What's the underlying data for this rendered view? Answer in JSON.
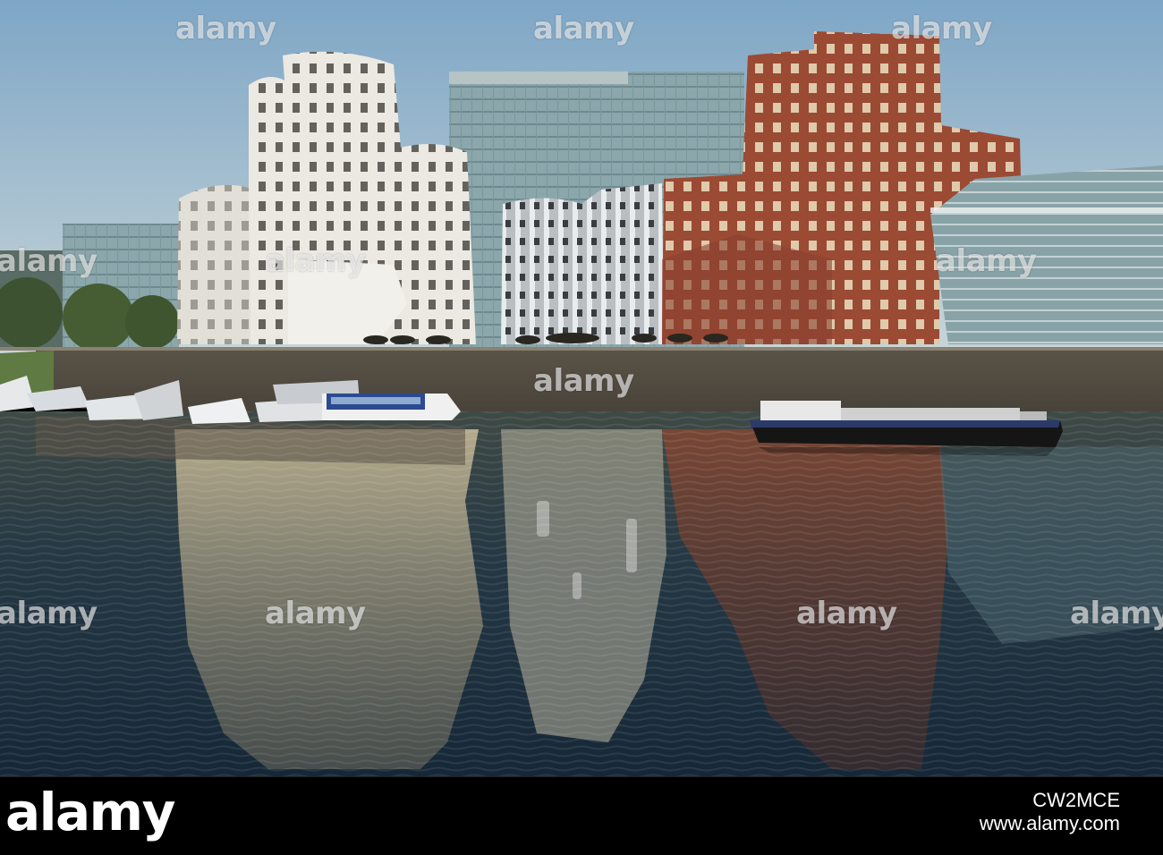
{
  "watermark": {
    "text": "alamy"
  },
  "footer": {
    "logo": "alamy",
    "image_id": "CW2MCE",
    "site": "www.alamy.com"
  },
  "colors": {
    "sky": "#9fc0d8",
    "water": "#1d3040",
    "white_building": "#e8e6e0",
    "brick_building": "#9a4a35",
    "glass_building": "#8faab0",
    "footer_bg": "#000000"
  }
}
